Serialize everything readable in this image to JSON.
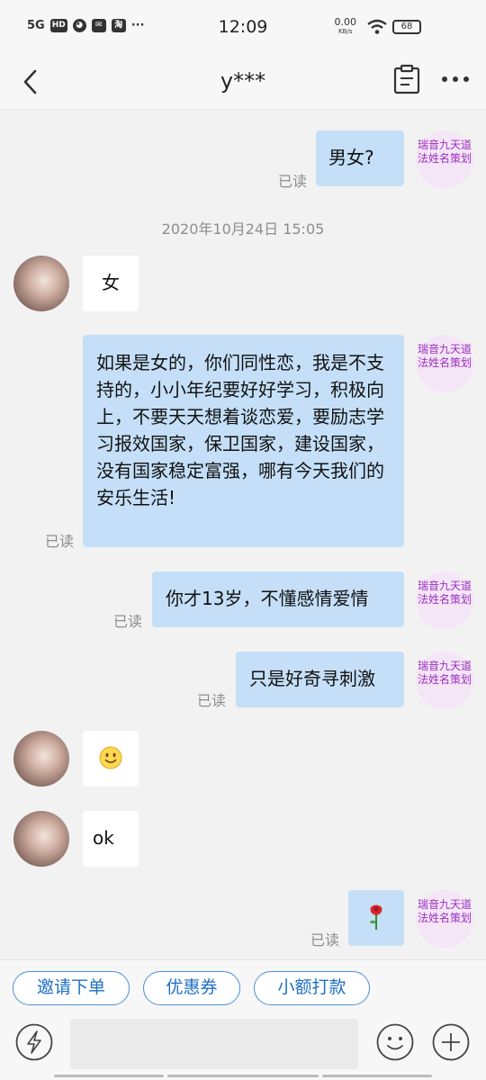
{
  "status_bar": {
    "network": "5G",
    "hd": "HD",
    "time": "12:09",
    "speed_value": "0.00",
    "speed_unit": "KB/s",
    "battery": "68"
  },
  "header": {
    "title": "y***"
  },
  "me": {
    "avatar_text": "瑞音九天道法姓名策划"
  },
  "read_label": "已读",
  "messages": [
    {
      "text": "男女?"
    },
    {
      "time": "2020年10月24日 15:05"
    },
    {
      "text": "女"
    },
    {
      "text": "如果是女的，你们同性恋，我是不支持的，小小年纪要好好学习，积极向上，不要天天想着谈恋爱，要励志学习报效国家，保卫国家，建设国家，没有国家稳定富强，哪有今天我们的安乐生活!"
    },
    {
      "text": "你才13岁，不懂感情爱情"
    },
    {
      "text": "只是好奇寻刺激"
    },
    {
      "emoji": "smile-emoji"
    },
    {
      "text": "ok"
    },
    {
      "emoji": "rose-emoji"
    }
  ],
  "quick_actions": [
    "邀请下单",
    "优惠券",
    "小额打款"
  ]
}
